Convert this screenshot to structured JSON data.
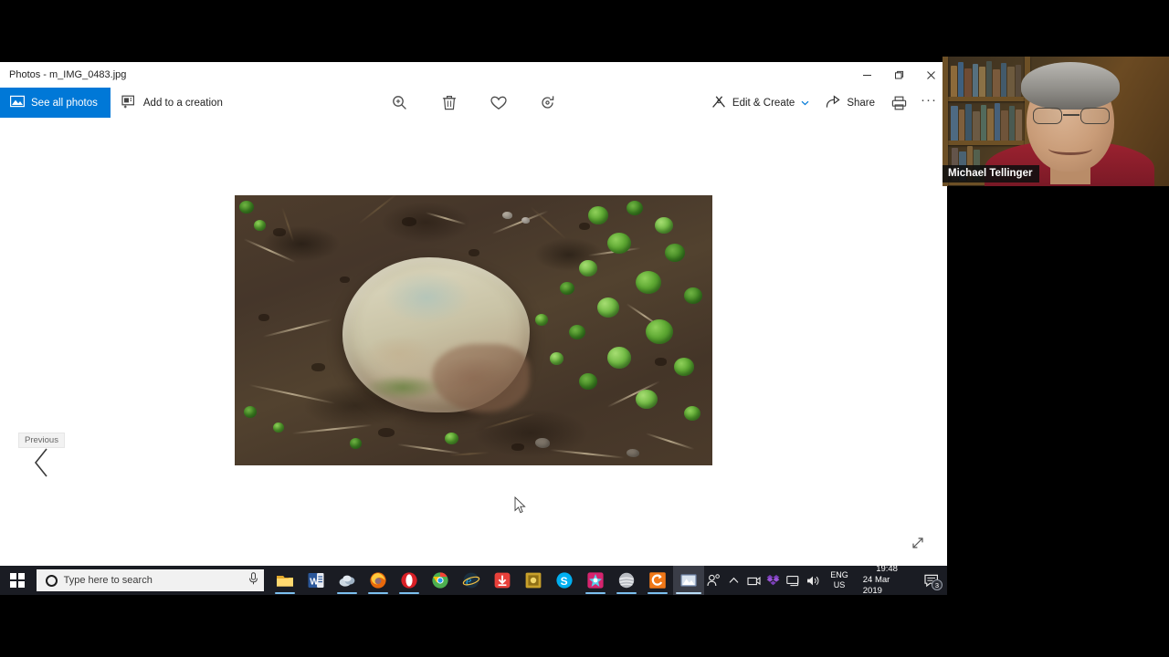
{
  "window": {
    "title": "Photos - m_IMG_0483.jpg",
    "controls": {
      "minimize": "minimize-icon",
      "restore": "restore-icon",
      "close": "close-icon"
    }
  },
  "commandbar": {
    "see_all_photos": "See all photos",
    "add_to_creation": "Add to a creation",
    "center_icons": [
      {
        "name": "zoom-icon",
        "label": "Zoom"
      },
      {
        "name": "delete-icon",
        "label": "Delete"
      },
      {
        "name": "heart-icon",
        "label": "Add to favorites"
      },
      {
        "name": "rotate-icon",
        "label": "Rotate"
      }
    ],
    "edit_create": "Edit & Create",
    "share": "Share",
    "print_icon": "print-icon",
    "more_icon": "more-options-icon",
    "more_label": "···"
  },
  "navigation": {
    "previous_tooltip": "Previous",
    "previous_icon": "chevron-left-icon",
    "fullscreen_icon": "fullscreen-expand-icon"
  },
  "photo": {
    "filename": "m_IMG_0483.jpg",
    "description": "Large rounded tan stone partly buried in dark brown soil with twigs, green round leaves on the right"
  },
  "webcam": {
    "participant_name": "Michael Tellinger"
  },
  "taskbar": {
    "start_icon": "windows-start-icon",
    "search_placeholder": "Type here to search",
    "search_circle_icon": "cortana-circle-icon",
    "mic_icon": "microphone-icon",
    "apps": [
      {
        "name": "file-explorer",
        "color": "#f6c244",
        "glyph": "folder",
        "running": true
      },
      {
        "name": "microsoft-word",
        "color": "#2b579a",
        "glyph": "W",
        "running": false
      },
      {
        "name": "cloud-app",
        "color": "#8fa6bd",
        "glyph": "cloud",
        "running": true
      },
      {
        "name": "firefox",
        "color": "#e8680b",
        "glyph": "circle",
        "running": true
      },
      {
        "name": "opera",
        "color": "#d91f26",
        "glyph": "circle",
        "running": true
      },
      {
        "name": "google-chrome",
        "color": "#4caf50",
        "glyph": "circle",
        "running": false
      },
      {
        "name": "internet-explorer",
        "color": "#1ba1e2",
        "glyph": "e",
        "running": false
      },
      {
        "name": "download-manager",
        "color": "#e8403a",
        "glyph": "arrow-down",
        "running": false
      },
      {
        "name": "gold-app",
        "color": "#c8a02a",
        "glyph": "square",
        "running": false
      },
      {
        "name": "skype",
        "color": "#00aff0",
        "glyph": "S",
        "running": false
      },
      {
        "name": "colorful-app",
        "color": "#d6246e",
        "glyph": "burst",
        "running": true
      },
      {
        "name": "silver-app",
        "color": "#b8bcc2",
        "glyph": "sphere",
        "running": true
      },
      {
        "name": "orange-swirl-app",
        "color": "#f07818",
        "glyph": "swirl",
        "running": true
      },
      {
        "name": "photos-app",
        "color": "#6f86a8",
        "glyph": "photo",
        "running": true,
        "active": true
      }
    ],
    "tray": [
      {
        "name": "people-icon"
      },
      {
        "name": "show-hidden-icons-chevron"
      },
      {
        "name": "tray-app-icon"
      },
      {
        "name": "dropbox-icon"
      },
      {
        "name": "network-icon"
      },
      {
        "name": "volume-icon"
      }
    ],
    "language_primary": "ENG",
    "language_secondary": "US",
    "time": "19:48",
    "date": "24 Mar 2019",
    "notification_icon": "action-center-icon",
    "notification_count": "3"
  },
  "colors": {
    "accent_blue": "#0078d7",
    "taskbar_bg": "#1a1c23",
    "window_bg": "#ffffff"
  }
}
